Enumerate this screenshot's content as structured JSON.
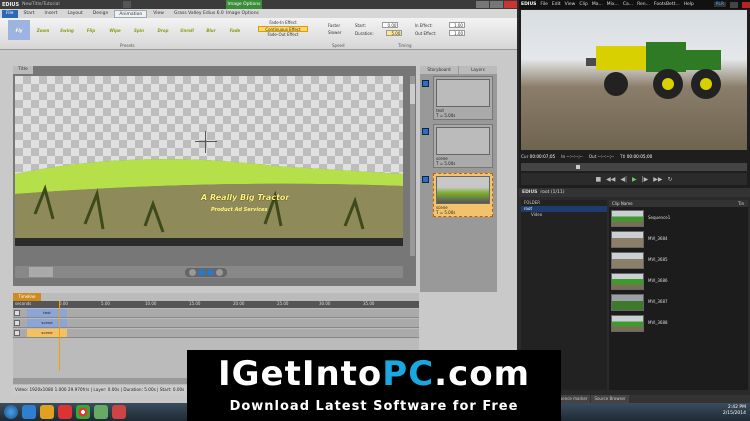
{
  "left_window": {
    "app": "EDIUS",
    "doc": "NewTitle/Tutorial",
    "context_tab": "Image Options",
    "context_sub": "Image Options",
    "ribbon_tabs": [
      "File",
      "Start",
      "Insert",
      "Layout",
      "Design",
      "Animation",
      "View",
      "Grass Valley Edius 6.0"
    ],
    "presets": [
      "Fly",
      "Zoom",
      "Swing",
      "Flip",
      "Wipe",
      "Spin",
      "Drop",
      "Unroll",
      "Blur",
      "Fade",
      "Spiral",
      "Focus"
    ],
    "groups": {
      "presets": "Presets",
      "speed": "Speed",
      "timing": "Timing"
    },
    "fade": {
      "in": "Fade-In Effect",
      "cont": "Continuous Effect",
      "out": "Fade-Out Effect"
    },
    "speed": [
      "Faster",
      "Slower"
    ],
    "timing": {
      "start_label": "Start:",
      "start_val": "0.00",
      "duration_label": "Duration:",
      "duration_val": "5.00",
      "in_label": "In Effect:",
      "in_val": "1.00",
      "out_label": "Out Effect:",
      "out_val": "1.00"
    },
    "canvas_tab": "Title",
    "title_line1": "A Really Big Tractor",
    "title_line2": "Product Ad Services",
    "panel_tabs": [
      "Storyboard",
      "Layers"
    ],
    "scenes": [
      {
        "name": "text",
        "dur": "T = 5.00s"
      },
      {
        "name": "scene",
        "dur": "T = 5.00s"
      },
      {
        "name": "scene",
        "dur": "T = 5.00s"
      }
    ],
    "timeline_tab": "Timeline",
    "ruler": [
      "seconds",
      "0.00",
      "5.00",
      "10.00",
      "15.00",
      "20.00",
      "25.00",
      "30.00",
      "35.00"
    ],
    "tracks": [
      "text",
      "scene",
      "scene"
    ],
    "status": "Video: 1920x1080 1.000   29.970fr/s | Layer: 0.00s | Duration: 5.00s | Start: 0.00s"
  },
  "right_window": {
    "app": "EDIUS",
    "menu": [
      "File",
      "Edit",
      "View",
      "Clip",
      "Ma...",
      "Mix...",
      "Ca...",
      "Ren...",
      "FootsBett...",
      "Help"
    ],
    "mode": "PLR",
    "timecodes": [
      {
        "label": "Cur",
        "value": "00:00:07;05"
      },
      {
        "label": "In",
        "value": "--:--:--;--"
      },
      {
        "label": "Out",
        "value": "--:--:--;--"
      },
      {
        "label": "Ttl",
        "value": "00:00:05;00"
      }
    ],
    "bin_title": "EDIUS",
    "bin_path": "root (1/11)",
    "folder_header": "FOLDER",
    "folders": [
      "root",
      "Video"
    ],
    "clip_headers": [
      "Clip Name",
      "Tin"
    ],
    "clips": [
      "Sequence1",
      "MVI_3684",
      "MVI_3685",
      "MVI_3686",
      "MVI_3687",
      "MVI_3688"
    ],
    "bottom_tabs": [
      "Information",
      "Sequence marker",
      "Source Browser"
    ]
  },
  "taskbar": {
    "time": "2:42 PM",
    "date": "2/15/2014"
  },
  "watermark": {
    "line1_a": "IGetInto",
    "line1_b": "PC",
    "line1_c": ".com",
    "line2": "Download Latest Software for Free"
  }
}
